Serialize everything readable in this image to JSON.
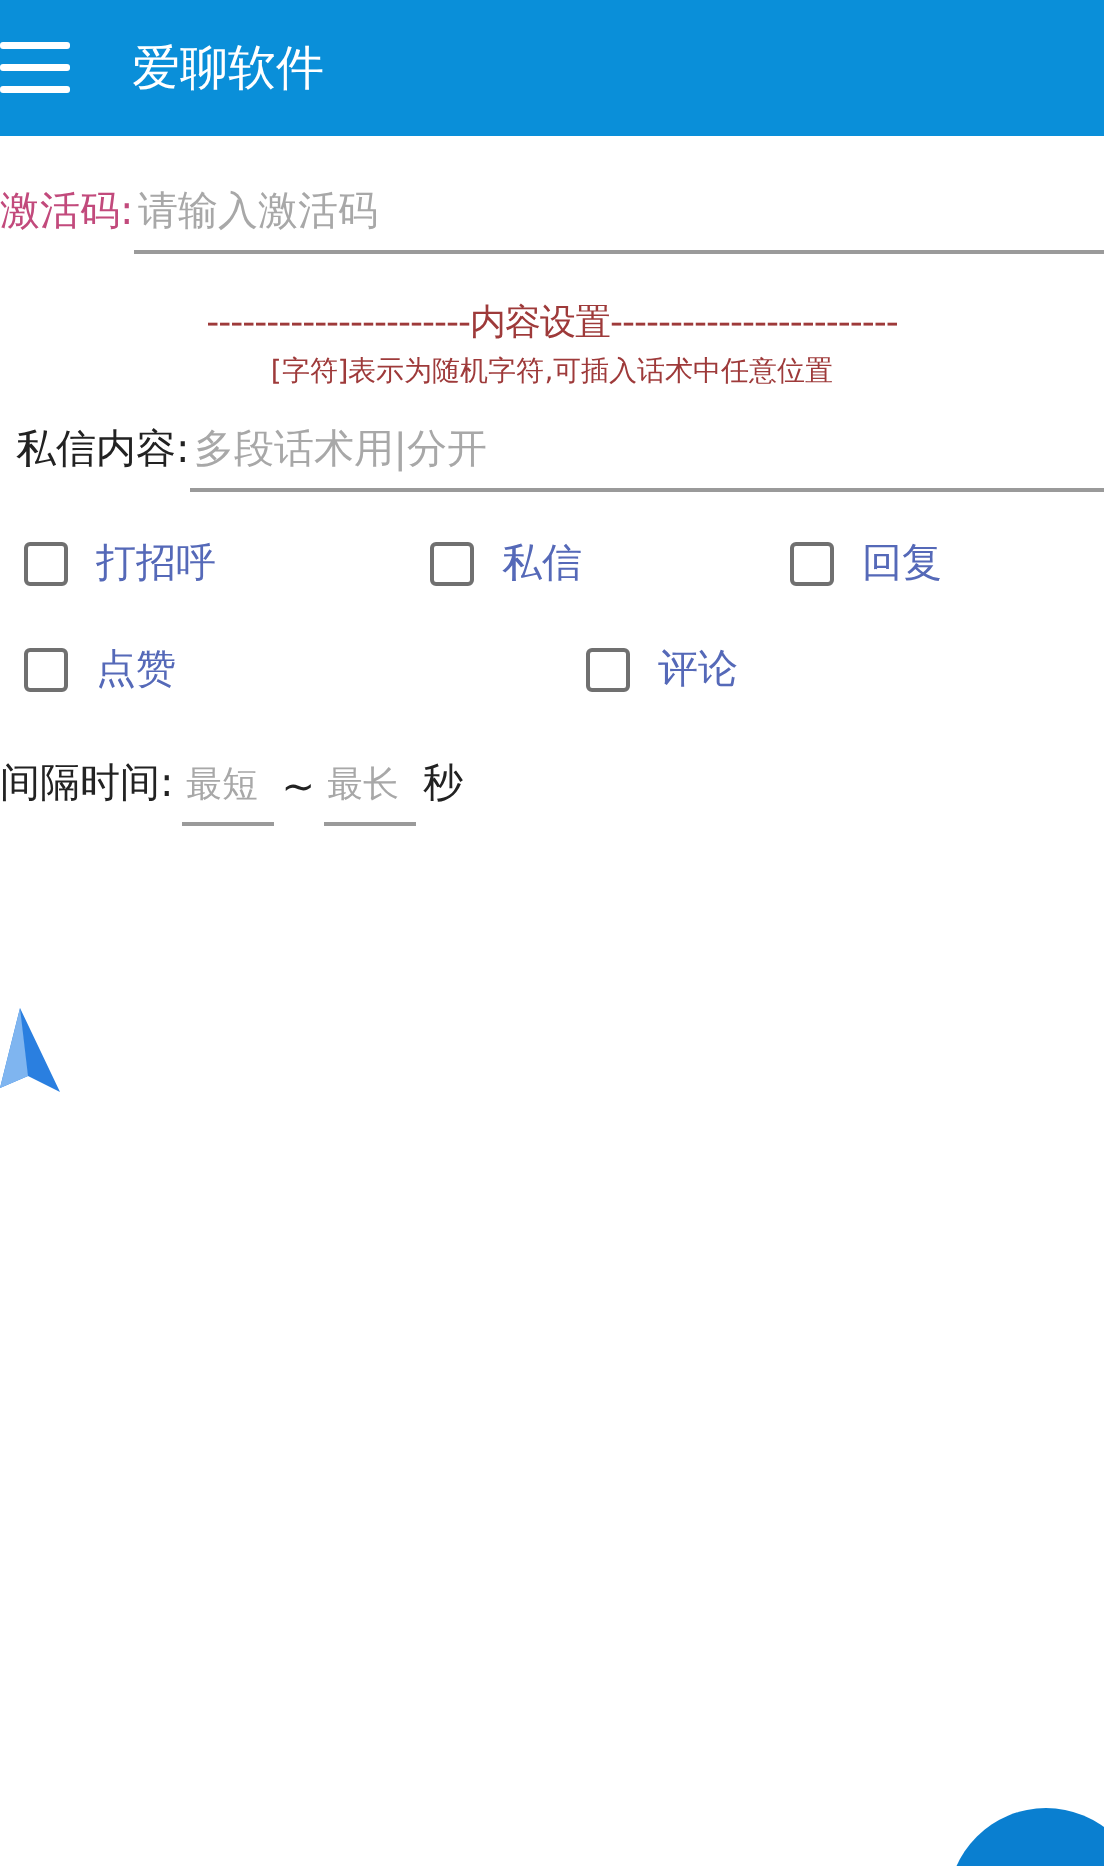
{
  "app_bar": {
    "title": "爱聊软件"
  },
  "activation": {
    "label": "激活码:",
    "placeholder": "请输入激活码"
  },
  "section": {
    "heading": "----------------------内容设置------------------------",
    "hint": "[字符]表示为随机字符,可插入话术中任意位置"
  },
  "message": {
    "label": "私信内容:",
    "placeholder": "多段话术用|分开"
  },
  "option_rows": [
    [
      {
        "label": "打招呼",
        "checked": false
      },
      {
        "label": "私信",
        "checked": false
      },
      {
        "label": "回复",
        "checked": false
      }
    ],
    [
      {
        "label": "点赞",
        "checked": false
      },
      {
        "label": "评论",
        "checked": false
      }
    ]
  ],
  "interval": {
    "label": "间隔时间:",
    "min_placeholder": "最短",
    "separator": "~",
    "max_placeholder": "最长",
    "unit": "秒"
  }
}
